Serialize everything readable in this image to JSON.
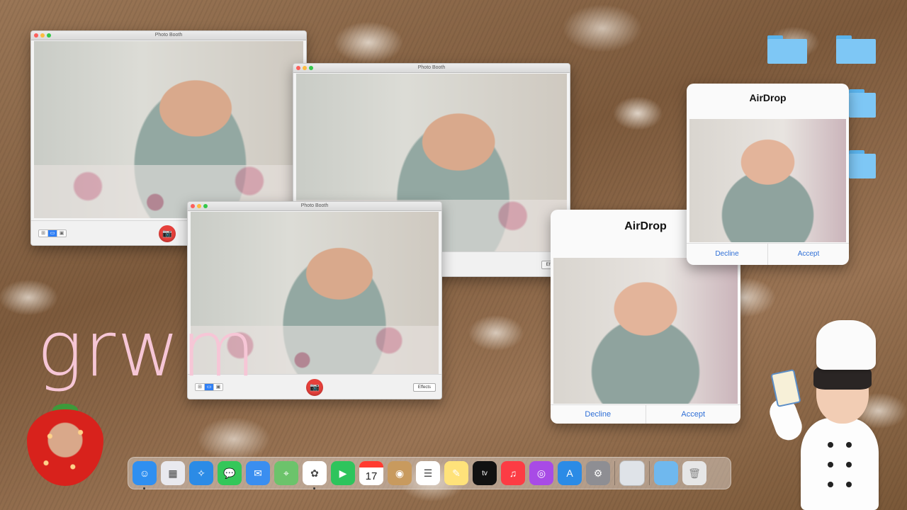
{
  "desktop": {
    "overlay_text": "grwm"
  },
  "photo_booth_windows": [
    {
      "title": "Photo Booth",
      "has_effects": false
    },
    {
      "title": "Photo Booth",
      "effects_label": "Effects"
    },
    {
      "title": "Photo Booth",
      "effects_label": "Effects"
    }
  ],
  "photo_booth_controls": {
    "view_modes": [
      "⊞",
      "▭",
      "▣"
    ],
    "shutter_icon": "📷"
  },
  "airdrop_cards": [
    {
      "title": "AirDrop",
      "decline_label": "Decline",
      "accept_label": "Accept"
    },
    {
      "title": "AirDrop",
      "decline_label": "Decline",
      "accept_label": "Accept"
    }
  ],
  "dock": {
    "calendar_date": "17",
    "apps": [
      {
        "name": "finder",
        "color": "#2f8ff0",
        "glyph": "☺"
      },
      {
        "name": "launchpad",
        "color": "#e9e9ee",
        "glyph": "▦"
      },
      {
        "name": "safari",
        "color": "#2b8be6",
        "glyph": "✧"
      },
      {
        "name": "messages",
        "color": "#34c759",
        "glyph": "💬"
      },
      {
        "name": "mail",
        "color": "#3a8ef0",
        "glyph": "✉"
      },
      {
        "name": "maps",
        "color": "#6cc36b",
        "glyph": "⌖"
      },
      {
        "name": "photos",
        "color": "#ffffff",
        "glyph": "✿"
      },
      {
        "name": "facetime",
        "color": "#2ec45c",
        "glyph": "▶"
      },
      {
        "name": "calendar",
        "color": "#ffffff",
        "glyph": ""
      },
      {
        "name": "finder-beige",
        "color": "#c89a5e",
        "glyph": "◉"
      },
      {
        "name": "reminders",
        "color": "#ffffff",
        "glyph": "☰"
      },
      {
        "name": "notes",
        "color": "#ffe27a",
        "glyph": "✎"
      },
      {
        "name": "apple-tv",
        "color": "#111111",
        "glyph": "tv"
      },
      {
        "name": "music",
        "color": "#fc3c44",
        "glyph": "♫"
      },
      {
        "name": "podcasts",
        "color": "#a84be6",
        "glyph": "◎"
      },
      {
        "name": "app-store",
        "color": "#2b8be6",
        "glyph": "A"
      },
      {
        "name": "system-preferences",
        "color": "#8e8e93",
        "glyph": "⚙"
      }
    ]
  },
  "colors": {
    "accent_blue": "#2f6fd6",
    "shutter_red": "#e6403b",
    "grwm_pink": "#f6c6d6",
    "folder_blue": "#7ec7f5"
  }
}
